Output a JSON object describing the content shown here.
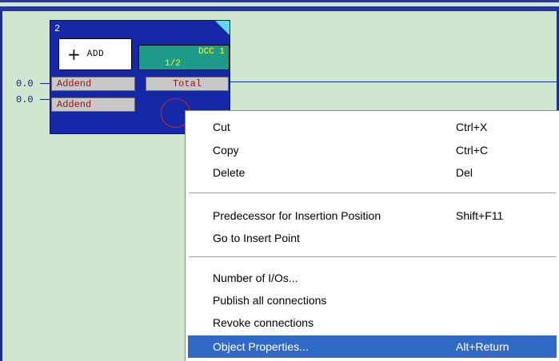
{
  "block": {
    "number": "2",
    "type_label": "ADD",
    "plus_symbol": "+",
    "cycle": "DCC 1",
    "ratio": "1/2",
    "inputs": [
      {
        "label": "Addend",
        "value": "0.0"
      },
      {
        "label": "Addend",
        "value": "0.0"
      }
    ],
    "output": {
      "label": "Total"
    }
  },
  "context_menu": {
    "items": [
      {
        "label": "Cut",
        "shortcut": "Ctrl+X"
      },
      {
        "label": "Copy",
        "shortcut": "Ctrl+C"
      },
      {
        "label": "Delete",
        "shortcut": "Del"
      },
      {
        "label": "Predecessor for Insertion Position",
        "shortcut": "Shift+F11"
      },
      {
        "label": "Go to Insert Point",
        "shortcut": ""
      },
      {
        "label": "Number of I/Os...",
        "shortcut": ""
      },
      {
        "label": "Publish all connections",
        "shortcut": ""
      },
      {
        "label": "Revoke connections",
        "shortcut": ""
      },
      {
        "label": "Object Properties...",
        "shortcut": "Alt+Return",
        "highlighted": true
      }
    ]
  },
  "colors": {
    "canvas_bg": "#cfe7cf",
    "block_bg": "#1528a8",
    "menu_highlight": "#316ac5",
    "port_text": "#9a1010"
  }
}
